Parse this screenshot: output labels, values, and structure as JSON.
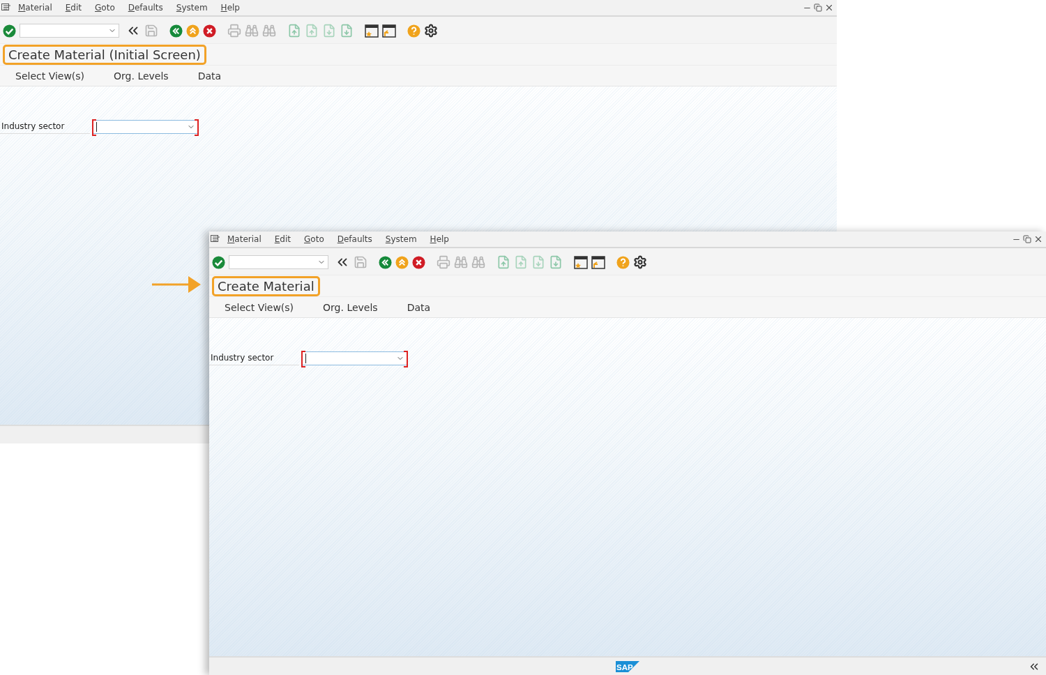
{
  "windows": [
    {
      "menu": [
        "Material",
        "Edit",
        "Goto",
        "Defaults",
        "System",
        "Help"
      ],
      "title": "Create Material (Initial Screen)",
      "title_highlighted": true,
      "app_toolbar": [
        "Select View(s)",
        "Org. Levels",
        "Data"
      ],
      "fields": [
        {
          "label": "Industry sector",
          "kind": "dropdown",
          "required": true
        }
      ]
    },
    {
      "menu": [
        "Material",
        "Edit",
        "Goto",
        "Defaults",
        "System",
        "Help"
      ],
      "title": "Create Material",
      "title_highlighted": true,
      "app_toolbar": [
        "Select View(s)",
        "Org. Levels",
        "Data"
      ],
      "fields": [
        {
          "label": "Industry sector",
          "kind": "dropdown",
          "required": true
        }
      ],
      "status_logo": "SAP"
    }
  ]
}
